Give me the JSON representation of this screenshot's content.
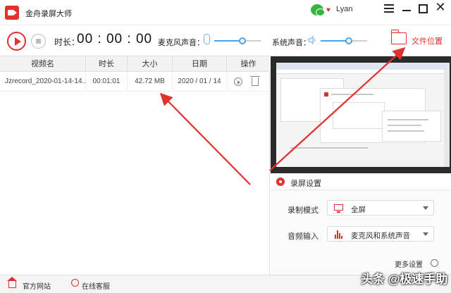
{
  "app": {
    "title": "金舟录屏大师"
  },
  "titlebar": {
    "user": "Lyan"
  },
  "toolbar": {
    "duration_label": "时长：",
    "duration_value": "00 : 00 : 00",
    "mic_label": "麦克风声音：",
    "mic_volume_percent": 60,
    "system_label": "系统声音：",
    "system_volume_percent": 60,
    "folder_label": "文件位置"
  },
  "table": {
    "columns": [
      "视频名",
      "时长",
      "大小",
      "日期",
      "操作"
    ],
    "rows": [
      {
        "name": "Jzrecord_2020-01-14-14...",
        "duration": "00:01:01",
        "size": "42.72 MB",
        "date": "2020 / 01 / 14"
      }
    ]
  },
  "settings": {
    "title": "录屏设置",
    "mode_label": "录制模式",
    "mode_value": "全屏",
    "audio_label": "音频输入",
    "audio_value": "麦克风和系统声音",
    "more": "更多设置"
  },
  "bottom": {
    "site": "官方网站",
    "service": "在线客服"
  },
  "watermark": "头条 @极速手助",
  "colors": {
    "accent": "#e0312c",
    "slider": "#4aa3e8",
    "annotation": "#e0312c"
  },
  "icons": [
    "record-icon",
    "stop-icon",
    "microphone-icon",
    "speaker-icon",
    "folder-icon",
    "play-icon",
    "trash-icon",
    "gear-icon",
    "monitor-icon",
    "audio-wave-icon",
    "home-icon",
    "headset-icon",
    "wechat-icon",
    "vip-diamond-icon",
    "menu-icon",
    "minimize-icon",
    "maximize-icon",
    "close-icon"
  ]
}
